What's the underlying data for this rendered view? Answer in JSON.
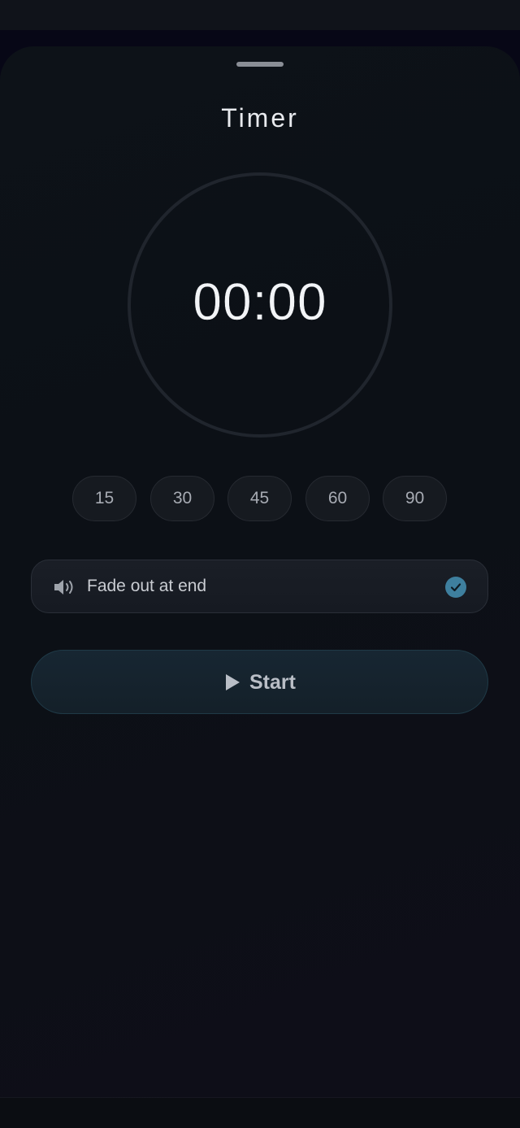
{
  "sheet": {
    "title": "Timer"
  },
  "timer": {
    "display": "00:00"
  },
  "presets": [
    "15",
    "30",
    "45",
    "60",
    "90"
  ],
  "fade_toggle": {
    "label": "Fade out at end",
    "checked": true,
    "icon": "speaker-icon",
    "check_icon": "checkmark-icon"
  },
  "start_button": {
    "label": "Start",
    "icon": "play-icon"
  },
  "colors": {
    "accent": "#3e7f9e",
    "background": "#0c1016",
    "text": "#e8eaee"
  }
}
